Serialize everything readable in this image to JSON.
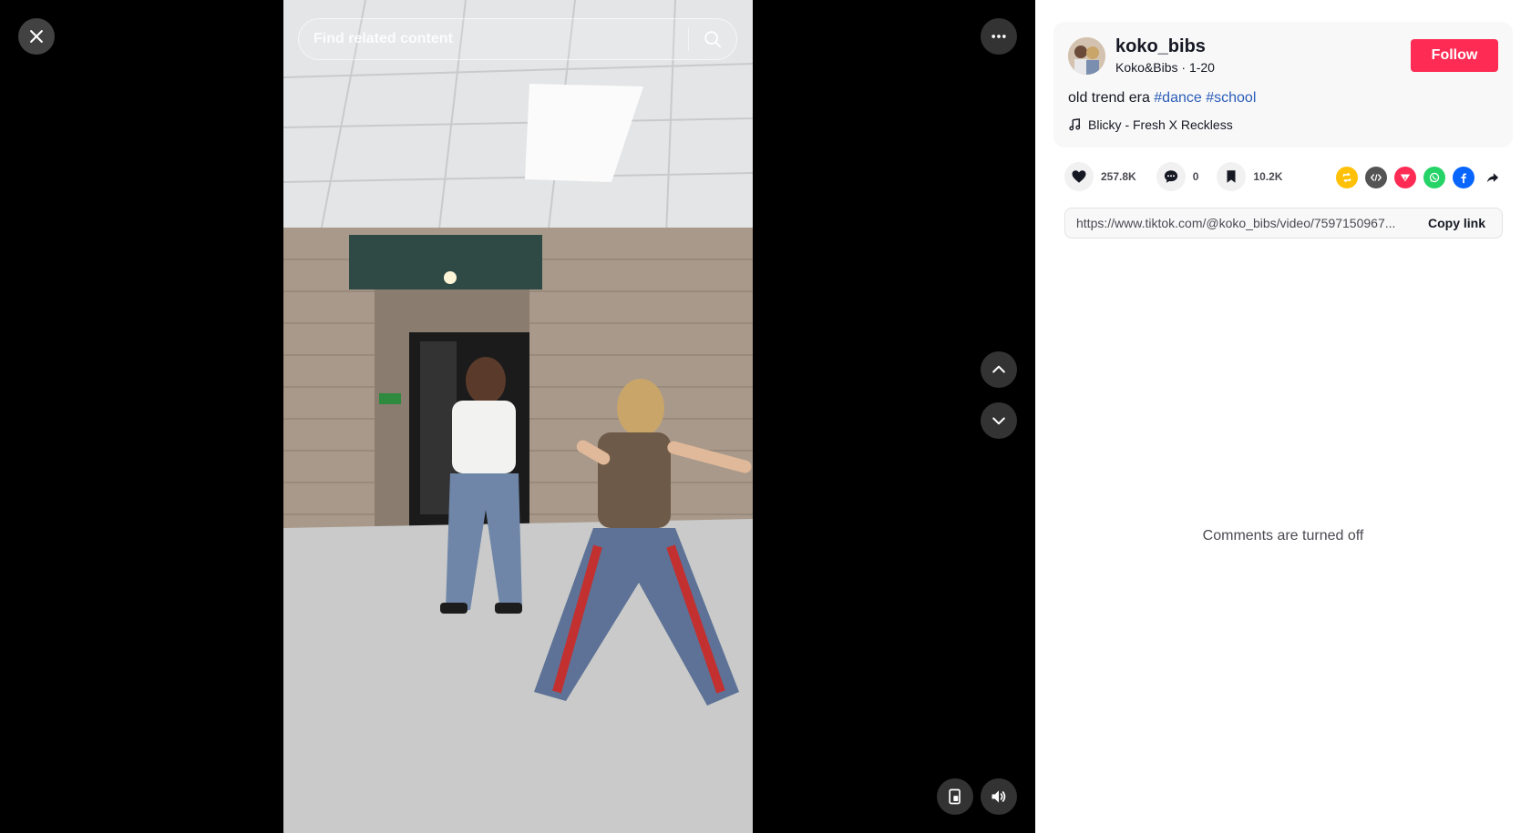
{
  "player": {
    "search_placeholder": "Find related content"
  },
  "post": {
    "username": "koko_bibs",
    "display_name": "Koko&Bibs",
    "date": "1-20",
    "separator": " · ",
    "caption_text": "old trend era ",
    "hashtags": [
      "#dance",
      "#school"
    ],
    "music": "Blicky - Fresh X Reckless",
    "follow_label": "Follow"
  },
  "stats": {
    "likes": "257.8K",
    "comments": "0",
    "saves": "10.2K"
  },
  "share_link": {
    "url": "https://www.tiktok.com/@koko_bibs/video/7597150967...",
    "copy_label": "Copy link"
  },
  "comments": {
    "status": "Comments are turned off"
  },
  "colors": {
    "accent": "#fe2c55",
    "hashtag": "#2b5db9",
    "repost": "#ffc107",
    "embed": "#545454",
    "send": "#fe2c55",
    "whatsapp": "#25d366",
    "facebook": "#0866ff"
  },
  "icons": {
    "close": "close-icon",
    "more": "more-icon",
    "search": "search-icon",
    "up": "chevron-up-icon",
    "down": "chevron-down-icon",
    "pip": "floating-player-icon",
    "volume": "volume-icon",
    "like": "heart-icon",
    "comment": "comment-icon",
    "save": "bookmark-icon",
    "music": "music-note-icon"
  }
}
